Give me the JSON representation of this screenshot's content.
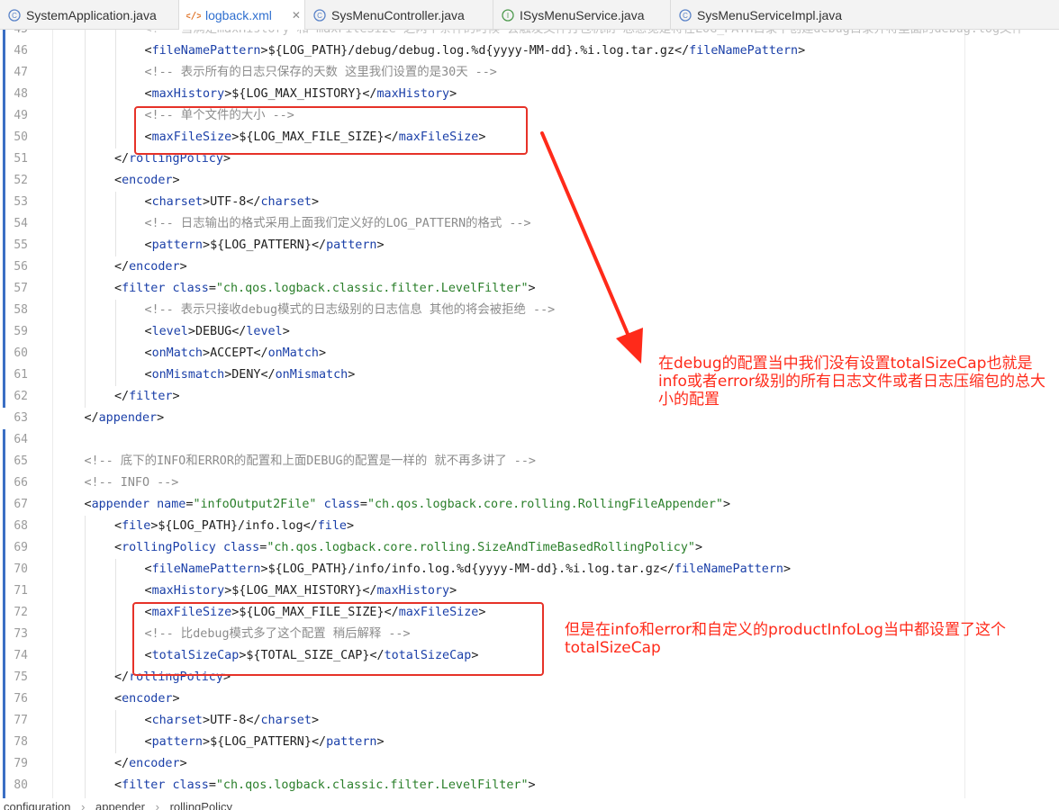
{
  "tabs": [
    {
      "label": "SystemApplication.java",
      "icon": "java-class-icon",
      "active": false
    },
    {
      "label": "logback.xml",
      "icon": "xml-file-icon",
      "active": true,
      "close": "✕"
    },
    {
      "label": "SysMenuController.java",
      "icon": "java-class-icon",
      "active": false
    },
    {
      "label": "ISysMenuService.java",
      "icon": "java-interface-icon",
      "active": false
    },
    {
      "label": "SysMenuServiceImpl.java",
      "icon": "java-class-icon",
      "active": false
    }
  ],
  "lines": [
    {
      "n": "45",
      "indent": 3,
      "tokens": [
        [
          "comment",
          "<!-- 当满足maxHistory 和 maxFileSize 之两个条件的时候 会触发文件打包机制 总感觉是将在LOG_PATH目录下创建debug目录并将里面的debug.log文件"
        ]
      ],
      "faded": true
    },
    {
      "n": "46",
      "indent": 3,
      "tokens": [
        [
          "punc",
          "<"
        ],
        [
          "tag",
          "fileNamePattern"
        ],
        [
          "punc",
          ">"
        ],
        [
          "text",
          "${LOG_PATH}/debug/debug.log.%d{yyyy-MM-dd}.%i.log.tar.gz"
        ],
        [
          "punc",
          "</"
        ],
        [
          "tag",
          "fileNamePattern"
        ],
        [
          "punc",
          ">"
        ]
      ]
    },
    {
      "n": "47",
      "indent": 3,
      "tokens": [
        [
          "comment",
          "<!-- 表示所有的日志只保存的天数 这里我们设置的是30天 -->"
        ]
      ]
    },
    {
      "n": "48",
      "indent": 3,
      "tokens": [
        [
          "punc",
          "<"
        ],
        [
          "tag",
          "maxHistory"
        ],
        [
          "punc",
          ">"
        ],
        [
          "text",
          "${LOG_MAX_HISTORY}"
        ],
        [
          "punc",
          "</"
        ],
        [
          "tag",
          "maxHistory"
        ],
        [
          "punc",
          ">"
        ]
      ]
    },
    {
      "n": "49",
      "indent": 3,
      "tokens": [
        [
          "comment",
          "<!-- 单个文件的大小 -->"
        ]
      ]
    },
    {
      "n": "50",
      "indent": 3,
      "tokens": [
        [
          "punc",
          "<"
        ],
        [
          "tag",
          "maxFileSize"
        ],
        [
          "punc",
          ">"
        ],
        [
          "text",
          "${LOG_MAX_FILE_SIZE}"
        ],
        [
          "punc",
          "</"
        ],
        [
          "tag",
          "maxFileSize"
        ],
        [
          "punc",
          ">"
        ]
      ]
    },
    {
      "n": "51",
      "indent": 2,
      "tokens": [
        [
          "punc",
          "</"
        ],
        [
          "tag",
          "rollingPolicy"
        ],
        [
          "punc",
          ">"
        ]
      ]
    },
    {
      "n": "52",
      "indent": 2,
      "tokens": [
        [
          "punc",
          "<"
        ],
        [
          "tag",
          "encoder"
        ],
        [
          "punc",
          ">"
        ]
      ]
    },
    {
      "n": "53",
      "indent": 3,
      "tokens": [
        [
          "punc",
          "<"
        ],
        [
          "tag",
          "charset"
        ],
        [
          "punc",
          ">"
        ],
        [
          "text",
          "UTF-8"
        ],
        [
          "punc",
          "</"
        ],
        [
          "tag",
          "charset"
        ],
        [
          "punc",
          ">"
        ]
      ]
    },
    {
      "n": "54",
      "indent": 3,
      "tokens": [
        [
          "comment",
          "<!-- 日志输出的格式采用上面我们定义好的LOG_PATTERN的格式 -->"
        ]
      ]
    },
    {
      "n": "55",
      "indent": 3,
      "tokens": [
        [
          "punc",
          "<"
        ],
        [
          "tag",
          "pattern"
        ],
        [
          "punc",
          ">"
        ],
        [
          "text",
          "${LOG_PATTERN}"
        ],
        [
          "punc",
          "</"
        ],
        [
          "tag",
          "pattern"
        ],
        [
          "punc",
          ">"
        ]
      ]
    },
    {
      "n": "56",
      "indent": 2,
      "tokens": [
        [
          "punc",
          "</"
        ],
        [
          "tag",
          "encoder"
        ],
        [
          "punc",
          ">"
        ]
      ]
    },
    {
      "n": "57",
      "indent": 2,
      "tokens": [
        [
          "punc",
          "<"
        ],
        [
          "tag",
          "filter"
        ],
        [
          "text",
          " "
        ],
        [
          "attr",
          "class"
        ],
        [
          "punc",
          "="
        ],
        [
          "aval",
          "\"ch.qos.logback.classic.filter.LevelFilter\""
        ],
        [
          "punc",
          ">"
        ]
      ]
    },
    {
      "n": "58",
      "indent": 3,
      "tokens": [
        [
          "comment",
          "<!-- 表示只接收debug模式的日志级别的日志信息 其他的将会被拒绝 -->"
        ]
      ]
    },
    {
      "n": "59",
      "indent": 3,
      "tokens": [
        [
          "punc",
          "<"
        ],
        [
          "tag",
          "level"
        ],
        [
          "punc",
          ">"
        ],
        [
          "text",
          "DEBUG"
        ],
        [
          "punc",
          "</"
        ],
        [
          "tag",
          "level"
        ],
        [
          "punc",
          ">"
        ]
      ]
    },
    {
      "n": "60",
      "indent": 3,
      "tokens": [
        [
          "punc",
          "<"
        ],
        [
          "tag",
          "onMatch"
        ],
        [
          "punc",
          ">"
        ],
        [
          "text",
          "ACCEPT"
        ],
        [
          "punc",
          "</"
        ],
        [
          "tag",
          "onMatch"
        ],
        [
          "punc",
          ">"
        ]
      ]
    },
    {
      "n": "61",
      "indent": 3,
      "tokens": [
        [
          "punc",
          "<"
        ],
        [
          "tag",
          "onMismatch"
        ],
        [
          "punc",
          ">"
        ],
        [
          "text",
          "DENY"
        ],
        [
          "punc",
          "</"
        ],
        [
          "tag",
          "onMismatch"
        ],
        [
          "punc",
          ">"
        ]
      ]
    },
    {
      "n": "62",
      "indent": 2,
      "tokens": [
        [
          "punc",
          "</"
        ],
        [
          "tag",
          "filter"
        ],
        [
          "punc",
          ">"
        ]
      ]
    },
    {
      "n": "63",
      "indent": 1,
      "tokens": [
        [
          "punc",
          "</"
        ],
        [
          "tag",
          "appender"
        ],
        [
          "punc",
          ">"
        ]
      ]
    },
    {
      "n": "64",
      "indent": 0,
      "tokens": []
    },
    {
      "n": "65",
      "indent": 1,
      "tokens": [
        [
          "comment",
          "<!-- 底下的INFO和ERROR的配置和上面DEBUG的配置是一样的 就不再多讲了 -->"
        ]
      ]
    },
    {
      "n": "66",
      "indent": 1,
      "tokens": [
        [
          "comment",
          "<!-- INFO -->"
        ]
      ]
    },
    {
      "n": "67",
      "indent": 1,
      "tokens": [
        [
          "punc",
          "<"
        ],
        [
          "tag",
          "appender"
        ],
        [
          "text",
          " "
        ],
        [
          "attr",
          "name"
        ],
        [
          "punc",
          "="
        ],
        [
          "aval",
          "\"infoOutput2File\""
        ],
        [
          "text",
          " "
        ],
        [
          "attr",
          "class"
        ],
        [
          "punc",
          "="
        ],
        [
          "aval",
          "\"ch.qos.logback.core.rolling.RollingFileAppender\""
        ],
        [
          "punc",
          ">"
        ]
      ]
    },
    {
      "n": "68",
      "indent": 2,
      "tokens": [
        [
          "punc",
          "<"
        ],
        [
          "tag",
          "file"
        ],
        [
          "punc",
          ">"
        ],
        [
          "text",
          "${LOG_PATH}/info.log"
        ],
        [
          "punc",
          "</"
        ],
        [
          "tag",
          "file"
        ],
        [
          "punc",
          ">"
        ]
      ]
    },
    {
      "n": "69",
      "indent": 2,
      "tokens": [
        [
          "punc",
          "<"
        ],
        [
          "tag",
          "rollingPolicy"
        ],
        [
          "text",
          " "
        ],
        [
          "attr",
          "class"
        ],
        [
          "punc",
          "="
        ],
        [
          "aval",
          "\"ch.qos.logback.core.rolling.SizeAndTimeBasedRollingPolicy\""
        ],
        [
          "punc",
          ">"
        ]
      ]
    },
    {
      "n": "70",
      "indent": 3,
      "tokens": [
        [
          "punc",
          "<"
        ],
        [
          "tag",
          "fileNamePattern"
        ],
        [
          "punc",
          ">"
        ],
        [
          "text",
          "${LOG_PATH}/info/info.log.%d{yyyy-MM-dd}.%i.log.tar.gz"
        ],
        [
          "punc",
          "</"
        ],
        [
          "tag",
          "fileNamePattern"
        ],
        [
          "punc",
          ">"
        ]
      ]
    },
    {
      "n": "71",
      "indent": 3,
      "tokens": [
        [
          "punc",
          "<"
        ],
        [
          "tag",
          "maxHistory"
        ],
        [
          "punc",
          ">"
        ],
        [
          "text",
          "${LOG_MAX_HISTORY}"
        ],
        [
          "punc",
          "</"
        ],
        [
          "tag",
          "maxHistory"
        ],
        [
          "punc",
          ">"
        ]
      ]
    },
    {
      "n": "72",
      "indent": 3,
      "tokens": [
        [
          "punc",
          "<"
        ],
        [
          "tag",
          "maxFileSize"
        ],
        [
          "punc",
          ">"
        ],
        [
          "text",
          "${LOG_MAX_FILE_SIZE}"
        ],
        [
          "punc",
          "</"
        ],
        [
          "tag",
          "maxFileSize"
        ],
        [
          "punc",
          ">"
        ]
      ]
    },
    {
      "n": "73",
      "indent": 3,
      "tokens": [
        [
          "comment",
          "<!-- 比debug模式多了这个配置 稍后解释 -->"
        ]
      ]
    },
    {
      "n": "74",
      "indent": 3,
      "tokens": [
        [
          "punc",
          "<"
        ],
        [
          "tag",
          "totalSizeCap"
        ],
        [
          "punc",
          ">"
        ],
        [
          "text",
          "${TOTAL_SIZE_CAP}"
        ],
        [
          "punc",
          "</"
        ],
        [
          "tag",
          "totalSizeCap"
        ],
        [
          "punc",
          ">"
        ]
      ]
    },
    {
      "n": "75",
      "indent": 2,
      "tokens": [
        [
          "punc",
          "</"
        ],
        [
          "tag",
          "rollingPolicy"
        ],
        [
          "punc",
          ">"
        ]
      ]
    },
    {
      "n": "76",
      "indent": 2,
      "tokens": [
        [
          "punc",
          "<"
        ],
        [
          "tag",
          "encoder"
        ],
        [
          "punc",
          ">"
        ]
      ]
    },
    {
      "n": "77",
      "indent": 3,
      "tokens": [
        [
          "punc",
          "<"
        ],
        [
          "tag",
          "charset"
        ],
        [
          "punc",
          ">"
        ],
        [
          "text",
          "UTF-8"
        ],
        [
          "punc",
          "</"
        ],
        [
          "tag",
          "charset"
        ],
        [
          "punc",
          ">"
        ]
      ]
    },
    {
      "n": "78",
      "indent": 3,
      "tokens": [
        [
          "punc",
          "<"
        ],
        [
          "tag",
          "pattern"
        ],
        [
          "punc",
          ">"
        ],
        [
          "text",
          "${LOG_PATTERN}"
        ],
        [
          "punc",
          "</"
        ],
        [
          "tag",
          "pattern"
        ],
        [
          "punc",
          ">"
        ]
      ]
    },
    {
      "n": "79",
      "indent": 2,
      "tokens": [
        [
          "punc",
          "</"
        ],
        [
          "tag",
          "encoder"
        ],
        [
          "punc",
          ">"
        ]
      ]
    },
    {
      "n": "80",
      "indent": 2,
      "tokens": [
        [
          "punc",
          "<"
        ],
        [
          "tag",
          "filter"
        ],
        [
          "text",
          " "
        ],
        [
          "attr",
          "class"
        ],
        [
          "punc",
          "="
        ],
        [
          "aval",
          "\"ch.qos.logback.classic.filter.LevelFilter\""
        ],
        [
          "punc",
          ">"
        ]
      ]
    }
  ],
  "annotations": {
    "note1": "在debug的配置当中我们没有设置totalSizeCap也就是info或者error级别的所有日志文件或者日志压缩包的总大小的配置",
    "note2": "但是在info和error和自定义的productInfoLog当中都设置了这个totalSizeCap",
    "color": "#ff2a1a"
  },
  "breadcrumb": [
    "configuration",
    "appender",
    "rollingPolicy"
  ],
  "colors": {
    "tag": "#1a3fa8",
    "attr_value": "#2a7f2a",
    "comment": "#8c8c8c",
    "active_tab_label": "#2f6fcf",
    "change_marker": "#3b6fc4"
  }
}
